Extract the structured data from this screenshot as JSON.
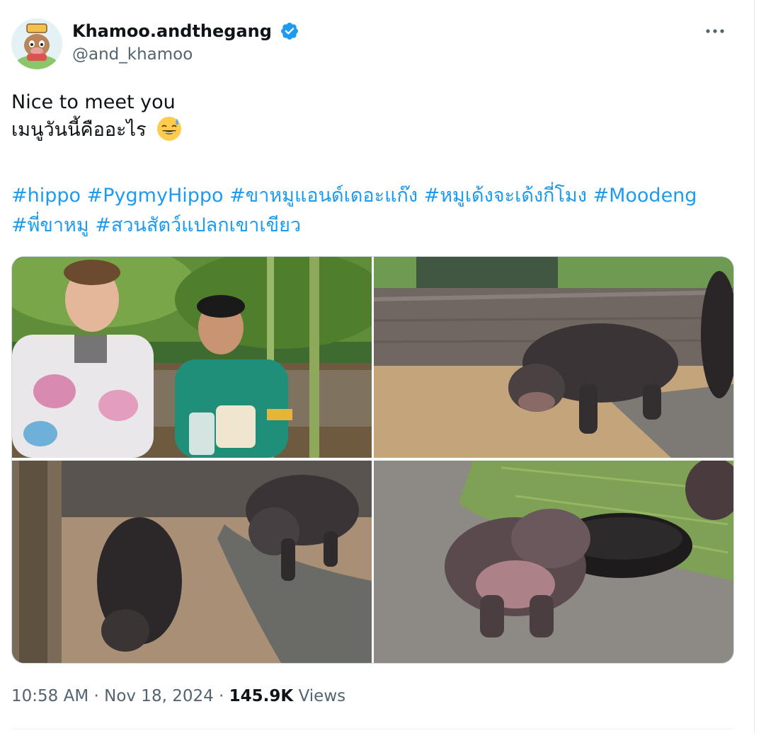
{
  "author": {
    "display_name": "Khamoo.andthegang",
    "handle": "@and_khamoo",
    "verified": true
  },
  "tweet": {
    "line1": "Nice to meet you",
    "line2": "เมนูวันนี้คืออะไร",
    "emoji": "grinning-sweat-emoji",
    "hashtags_line1": [
      "#hippo",
      "#PygmyHippo",
      "#ขาหมูแอนด์เดอะแก๊ง",
      "#หมูเด้งจะเด้งกี่โมง",
      "#Moodeng"
    ],
    "hashtags_line2": [
      "#พี่ขาหมู",
      "#สวนสัตว์แปลกเขาเขียว"
    ]
  },
  "media": {
    "count": 4,
    "tiles": [
      "two-men-at-zoo-photo",
      "pygmy-hippo-in-enclosure-photo",
      "two-wet-hippos-photo",
      "baby-hippo-by-water-tub-photo"
    ]
  },
  "meta": {
    "time": "10:58 AM",
    "separator": "·",
    "date": "Nov 18, 2024",
    "views_count": "145.9K",
    "views_label": "Views"
  },
  "colors": {
    "link": "#1d9bf0",
    "secondary_text": "#536471",
    "primary_text": "#0f1419",
    "verified_badge": "#1d9bf0"
  }
}
